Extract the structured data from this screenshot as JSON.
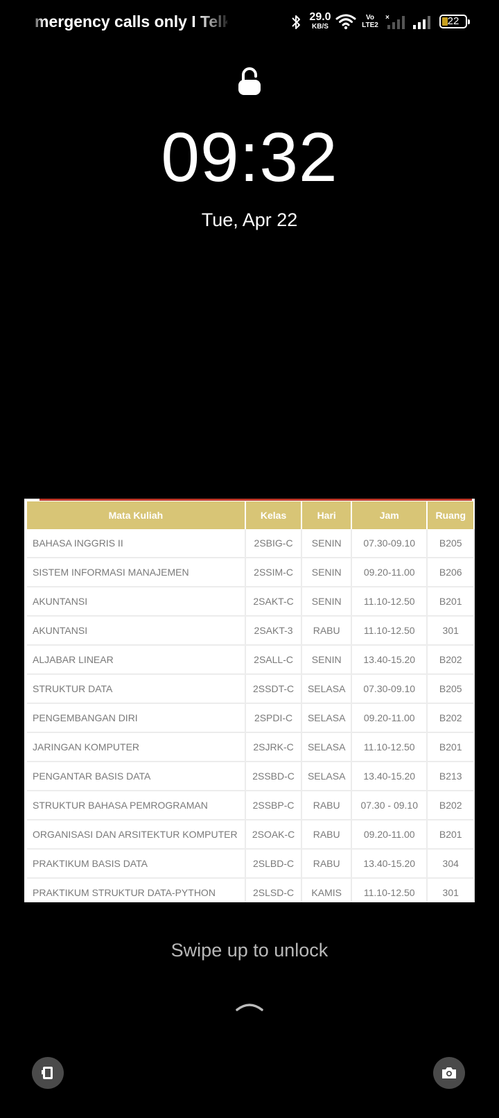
{
  "status_bar": {
    "carrier_text": "mergency calls only I Telk",
    "net_speed_value": "29.0",
    "net_speed_unit": "KB/S",
    "volte_top": "Vo",
    "volte_bottom": "LTE2",
    "battery_level": "22",
    "icons": [
      "bluetooth-icon",
      "wifi-icon",
      "signal-icon",
      "battery-icon"
    ],
    "battery_color": "#c8a020"
  },
  "lockscreen": {
    "time": "09:32",
    "date": "Tue, Apr 22",
    "unlock_hint": "Swipe up to unlock",
    "icons": [
      "lock-icon",
      "chevron-up-icon",
      "phone-icon",
      "camera-icon"
    ]
  },
  "wallpaper_table": {
    "header_color": "#d8c576",
    "columns": [
      "Mata Kuliah",
      "Kelas",
      "Hari",
      "Jam",
      "Ruang"
    ],
    "rows": [
      [
        "BAHASA INGGRIS II",
        "2SBIG-C",
        "SENIN",
        "07.30-09.10",
        "B205"
      ],
      [
        "SISTEM INFORMASI MANAJEMEN",
        "2SSIM-C",
        "SENIN",
        "09.20-11.00",
        "B206"
      ],
      [
        "AKUNTANSI",
        "2SAKT-C",
        "SENIN",
        "11.10-12.50",
        "B201"
      ],
      [
        "AKUNTANSI",
        "2SAKT-3",
        "RABU",
        "11.10-12.50",
        "301"
      ],
      [
        "ALJABAR LINEAR",
        "2SALL-C",
        "SENIN",
        "13.40-15.20",
        "B202"
      ],
      [
        "STRUKTUR DATA",
        "2SSDT-C",
        "SELASA",
        "07.30-09.10",
        "B205"
      ],
      [
        "PENGEMBANGAN DIRI",
        "2SPDI-C",
        "SELASA",
        "09.20-11.00",
        "B202"
      ],
      [
        "JARINGAN KOMPUTER",
        "2SJRK-C",
        "SELASA",
        "11.10-12.50",
        "B201"
      ],
      [
        "PENGANTAR BASIS DATA",
        "2SSBD-C",
        "SELASA",
        "13.40-15.20",
        "B213"
      ],
      [
        "STRUKTUR BAHASA PEMROGRAMAN",
        "2SSBP-C",
        "RABU",
        "07.30 - 09.10",
        "B202"
      ],
      [
        "ORGANISASI DAN ARSITEKTUR KOMPUTER",
        "2SOAK-C",
        "RABU",
        "09.20-11.00",
        "B201"
      ],
      [
        "PRAKTIKUM BASIS DATA",
        "2SLBD-C",
        "RABU",
        "13.40-15.20",
        "304"
      ],
      [
        "PRAKTIKUM STRUKTUR DATA-PYTHON",
        "2SLSD-C",
        "KAMIS",
        "11.10-12.50",
        "301"
      ]
    ]
  }
}
